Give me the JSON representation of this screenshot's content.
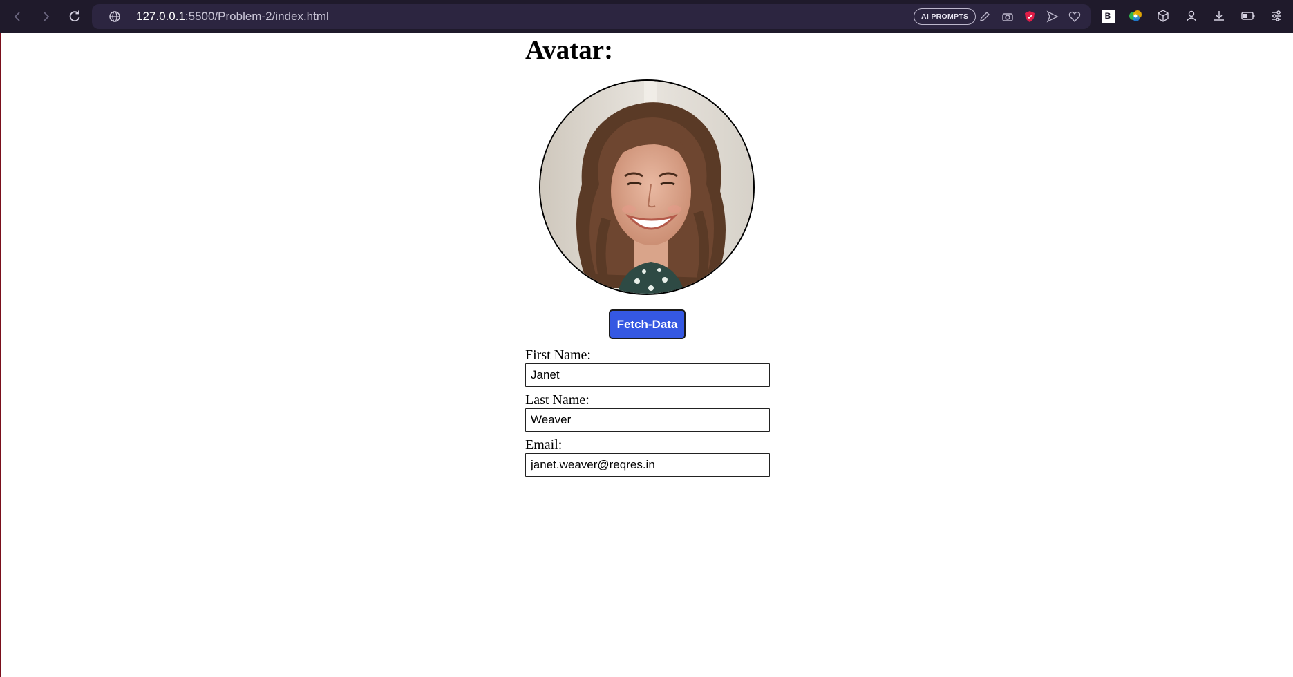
{
  "browser": {
    "url_host": "127.0.0.1",
    "url_rest": ":5500/Problem-2/index.html",
    "ai_prompts_label": "AI PROMPTS",
    "ext_badge": "B",
    "icons": [
      "back-icon",
      "forward-icon",
      "reload-icon",
      "globe-icon",
      "edit-icon",
      "camera-icon",
      "shield-icon",
      "send-icon",
      "heart-icon",
      "extension-b-icon",
      "colorful-extension-icon",
      "cube-icon",
      "profile-icon",
      "download-icon",
      "battery-icon",
      "settings-icon"
    ],
    "accent": "#e11d48"
  },
  "page": {
    "heading": "Avatar:",
    "fetch_button": "Fetch-Data",
    "fields": {
      "first_name": {
        "label": "First Name:",
        "value": "Janet"
      },
      "last_name": {
        "label": "Last Name:",
        "value": "Weaver"
      },
      "email": {
        "label": "Email:",
        "value": "janet.weaver@reqres.in"
      }
    },
    "button_color": "#3558e2"
  }
}
